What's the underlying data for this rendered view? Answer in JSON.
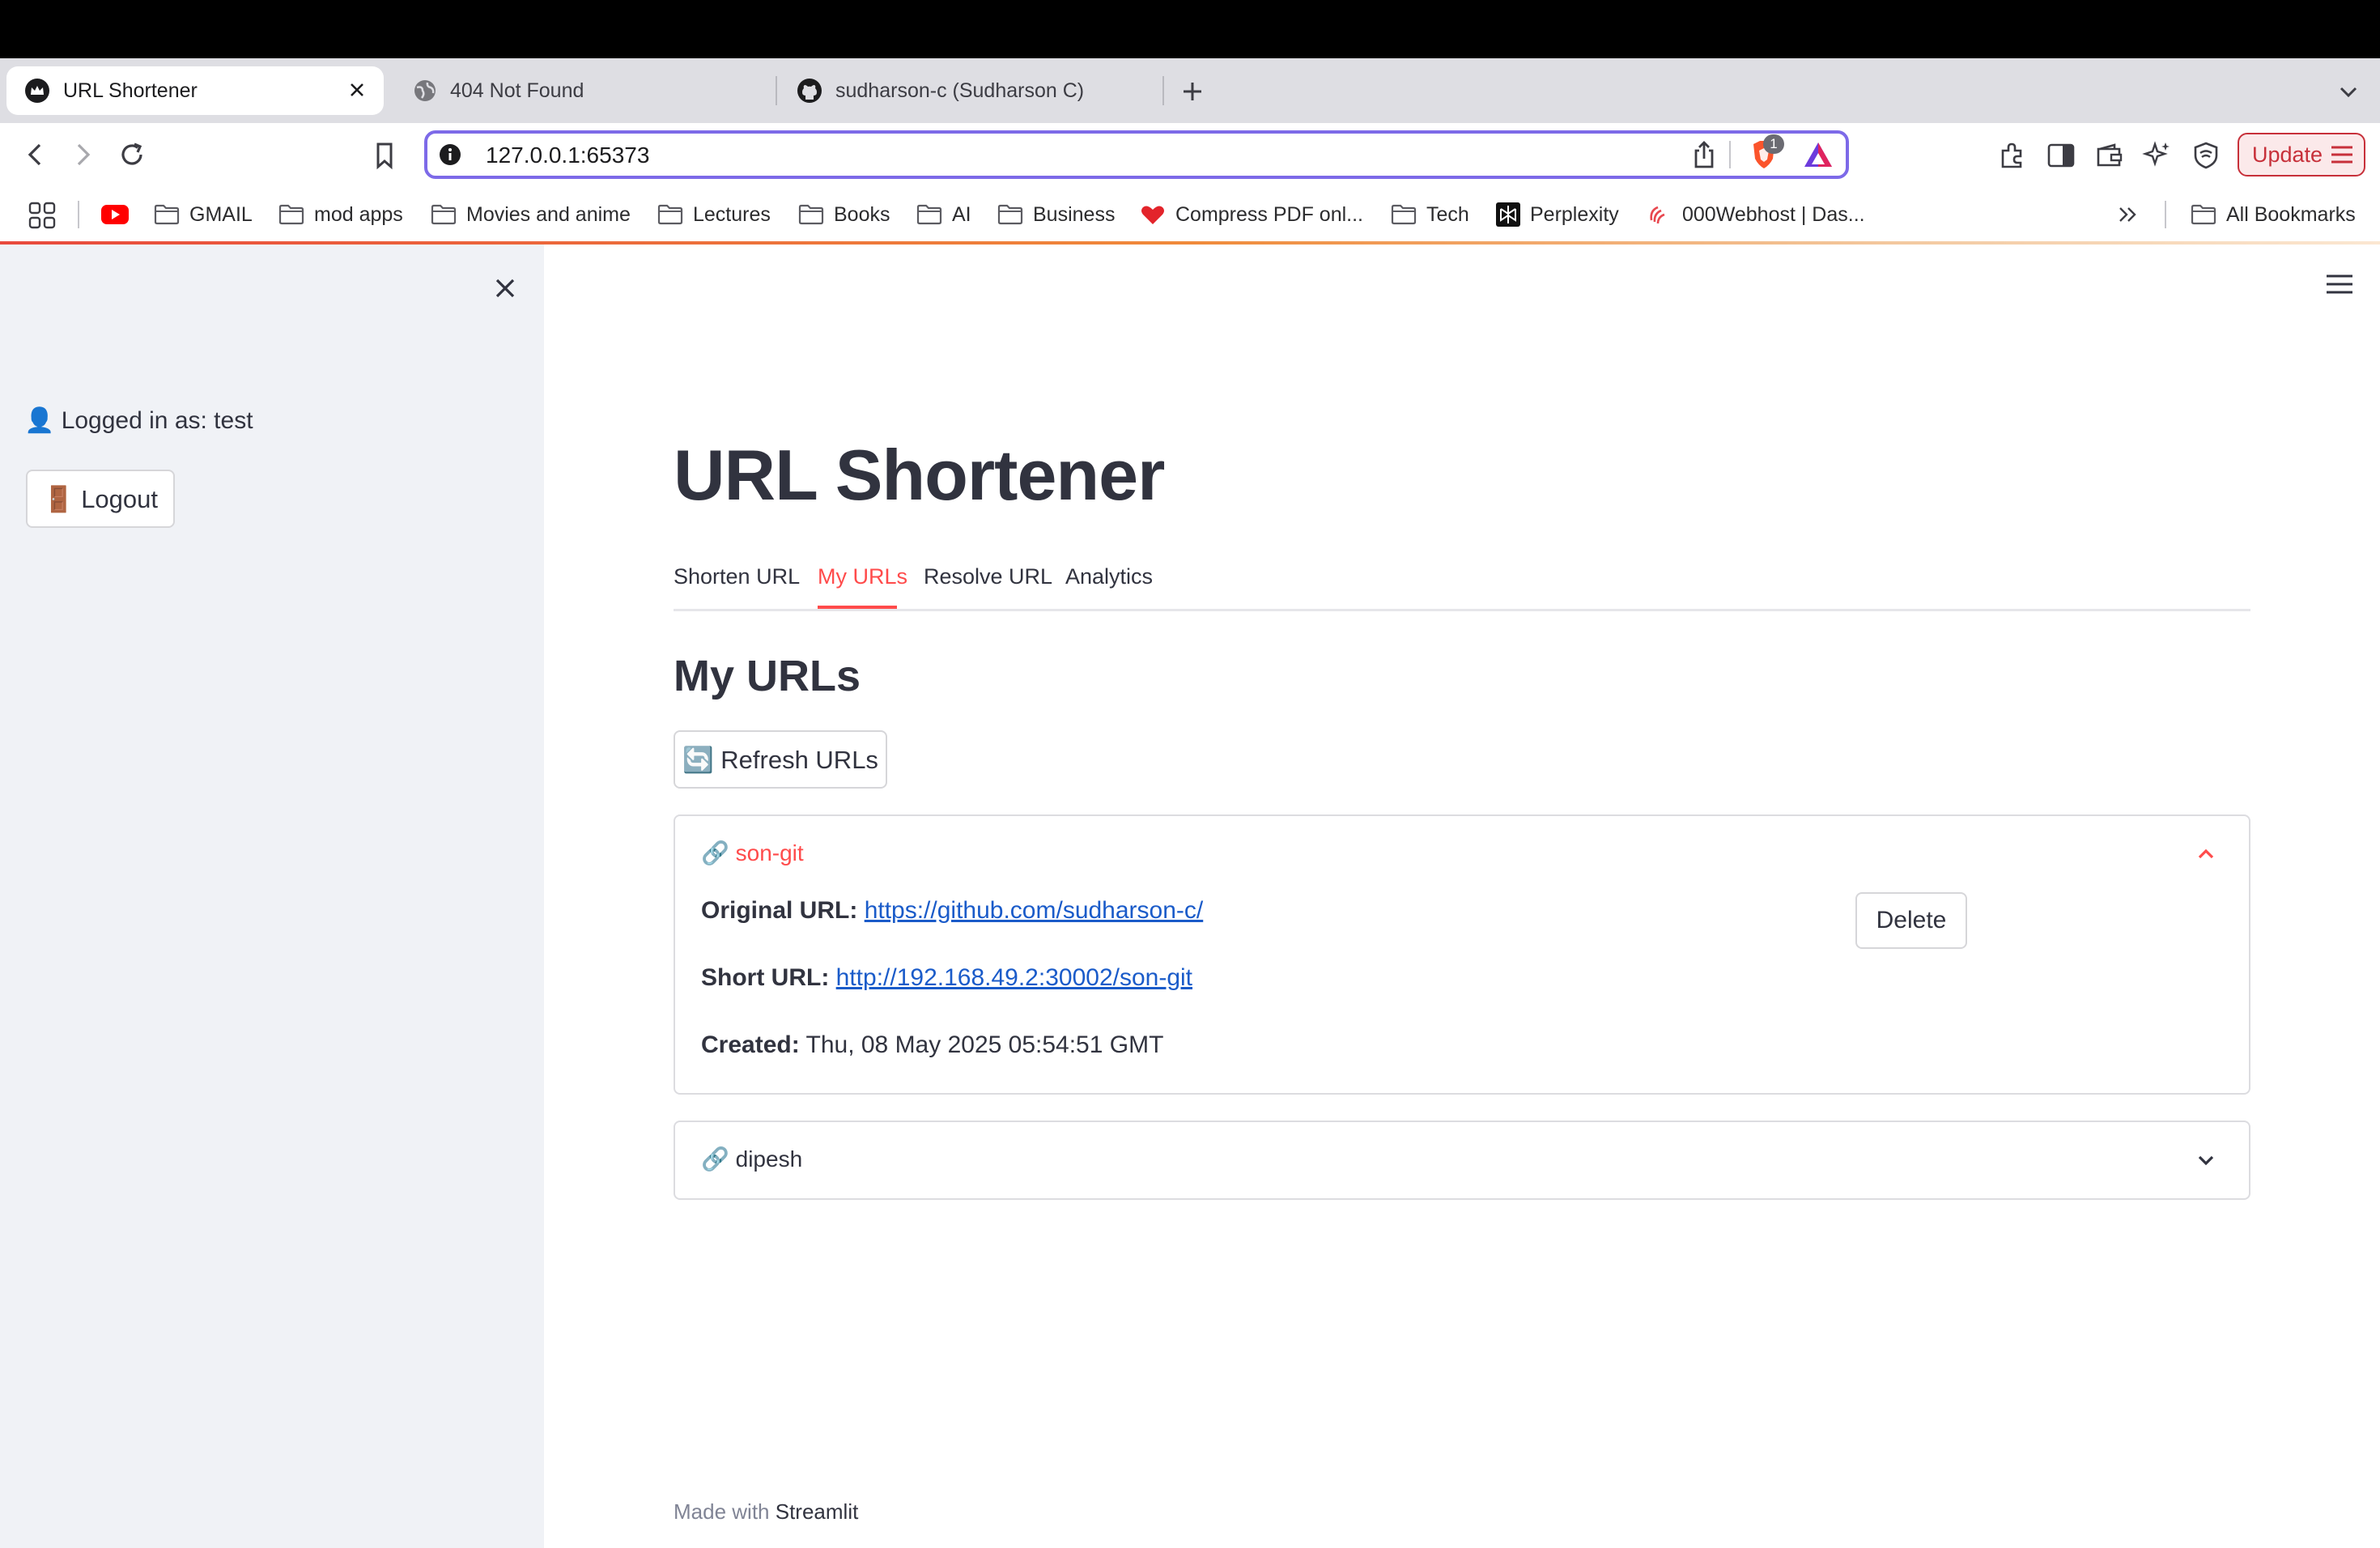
{
  "browser": {
    "tabs": [
      {
        "title": "URL Shortener",
        "icon": "streamlit-crown-icon",
        "active": true
      },
      {
        "title": "404 Not Found",
        "icon": "globe-icon",
        "active": false
      },
      {
        "title": "sudharson-c (Sudharson C)",
        "icon": "github-icon",
        "active": false
      }
    ],
    "address": "127.0.0.1:65373",
    "shields_badge": "1",
    "update_label": "Update",
    "bookmarks": [
      {
        "label": "",
        "icon": "youtube-icon"
      },
      {
        "label": "GMAIL",
        "icon": "folder-icon"
      },
      {
        "label": "mod apps",
        "icon": "folder-icon"
      },
      {
        "label": "Movies and anime",
        "icon": "folder-icon"
      },
      {
        "label": "Lectures",
        "icon": "folder-icon"
      },
      {
        "label": "Books",
        "icon": "folder-icon"
      },
      {
        "label": "AI",
        "icon": "folder-icon"
      },
      {
        "label": "Business",
        "icon": "folder-icon"
      },
      {
        "label": "Compress PDF onl...",
        "icon": "heart-icon"
      },
      {
        "label": "Tech",
        "icon": "folder-icon"
      },
      {
        "label": "Perplexity",
        "icon": "perplexity-icon"
      },
      {
        "label": "000Webhost | Das...",
        "icon": "webhost-icon"
      }
    ],
    "all_bookmarks_label": "All Bookmarks"
  },
  "sidebar": {
    "logged_in_text": "👤 Logged in as: test",
    "logout_label": "🚪 Logout"
  },
  "main": {
    "title": "URL Shortener",
    "tabs": [
      {
        "label": "Shorten URL",
        "active": false
      },
      {
        "label": "My URLs",
        "active": true
      },
      {
        "label": "Resolve URL",
        "active": false
      },
      {
        "label": "Analytics",
        "active": false
      }
    ],
    "section_title": "My URLs",
    "refresh_label": "🔄 Refresh URLs",
    "urls": [
      {
        "label": "🔗 son-git",
        "expanded": true,
        "original_label": "Original URL:",
        "original_url": "https://github.com/sudharson-c/",
        "short_label": "Short URL:",
        "short_url": "http://192.168.49.2:30002/son-git",
        "created_label": "Created:",
        "created": "Thu, 08 May 2025 05:54:51 GMT",
        "delete_label": "Delete"
      },
      {
        "label": "🔗 dipesh",
        "expanded": false
      }
    ],
    "footer_prefix": "Made with",
    "footer_brand": "Streamlit"
  },
  "colors": {
    "accent": "#ff4b4b",
    "link": "#1a5bc9",
    "sidebar_bg": "#f0f2f6",
    "text": "#31333f"
  }
}
